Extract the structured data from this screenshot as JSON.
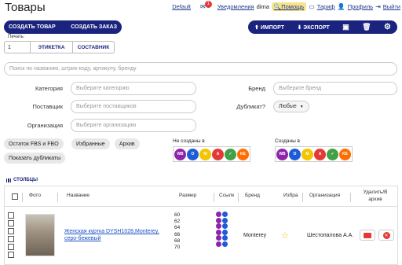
{
  "page": {
    "title": "Товары"
  },
  "topbar": {
    "default_label": "Default",
    "mail_badge": "1",
    "notifications": "Уведомления",
    "user": "dima",
    "help": "Помощь",
    "tariff": "Тариф",
    "profile": "Профиль",
    "logout": "Выйти"
  },
  "actions": {
    "create_product": "СОЗДАТЬ ТОВАР",
    "create_order": "СОЗДАТЬ ЗАКАЗ",
    "import": "ИМПОРТ",
    "export": "ЭКСПОРТ"
  },
  "print": {
    "label": "Печать:",
    "qty": "1",
    "label_btn": "ЭТИКЕТКА",
    "composition_btn": "СОСТАВНИК"
  },
  "search": {
    "placeholder": "Поиск по названию, штрих-коду, артикулу, бренду"
  },
  "filters": {
    "category_label": "Категория",
    "category_placeholder": "Выберите категорию",
    "supplier_label": "Поставщик",
    "supplier_placeholder": "Выберите поставщиков",
    "org_label": "Организация",
    "org_placeholder": "Выберите организацию",
    "brand_label": "Бренд",
    "brand_placeholder": "Выберите бренд",
    "duplicate_label": "Дубликат?",
    "duplicate_value": "Любые"
  },
  "chips": {
    "stock": "Остаток FBS и FBO",
    "favorites": "Избранные",
    "archive": "Архив",
    "show_duplicates": "Показать дубликаты"
  },
  "marketplaces": {
    "not_created_label": "Не созданы в",
    "created_label": "Созданы в",
    "icons": [
      {
        "name": "wildberries",
        "text": "WB",
        "color": "#8e24aa"
      },
      {
        "name": "ozon",
        "text": "O",
        "color": "#1e5bd8"
      },
      {
        "name": "yandex-market",
        "text": "M",
        "color": "#f5c400"
      },
      {
        "name": "aliexpress",
        "text": "A",
        "color": "#e53935"
      },
      {
        "name": "sber",
        "text": "✓",
        "color": "#43a047"
      },
      {
        "name": "kazanexpress",
        "text": "KE",
        "color": "#ff6d00"
      }
    ]
  },
  "table": {
    "columns_link": "СТОЛБЦЫ",
    "headers": {
      "photo": "Фото",
      "name": "Название",
      "size": "Размер",
      "links": "Ссылк",
      "brand": "Бренд",
      "favorite": "Избра",
      "organization": "Организация",
      "delete_archive": "Удалить/В архив"
    },
    "row": {
      "name": "Женская куртка DYSH1028,Monterey, серо-бежевый",
      "sizes": [
        "60",
        "62",
        "64",
        "66",
        "68",
        "70"
      ],
      "brand": "Monterey",
      "organization": "Шестопалова А.А."
    }
  }
}
